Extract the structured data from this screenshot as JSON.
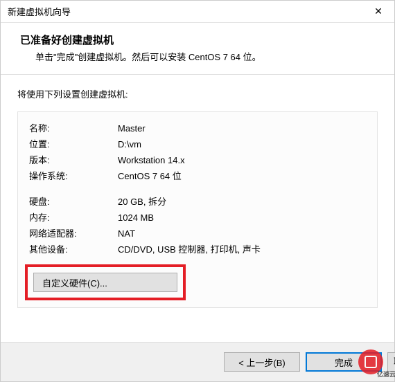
{
  "titlebar": {
    "title": "新建虚拟机向导",
    "close_label": "✕"
  },
  "header": {
    "title": "已准备好创建虚拟机",
    "desc": "单击\"完成\"创建虚拟机。然后可以安装 CentOS 7 64 位。"
  },
  "content": {
    "list_label": "将使用下列设置创建虚拟机:",
    "rows": [
      {
        "label": "名称:",
        "value": "Master"
      },
      {
        "label": "位置:",
        "value": "D:\\vm"
      },
      {
        "label": "版本:",
        "value": "Workstation 14.x"
      },
      {
        "label": "操作系统:",
        "value": "CentOS 7 64 位"
      }
    ],
    "rows2": [
      {
        "label": "硬盘:",
        "value": "20 GB, 拆分"
      },
      {
        "label": "内存:",
        "value": "1024 MB"
      },
      {
        "label": "网络适配器:",
        "value": "NAT"
      },
      {
        "label": "其他设备:",
        "value": "CD/DVD, USB 控制器, 打印机, 声卡"
      }
    ],
    "custom_hw_label": "自定义硬件(C)..."
  },
  "footer": {
    "back_label": "< 上一步(B)",
    "finish_label": "完成",
    "cancel_label": "取消"
  },
  "watermark": {
    "text": "亿速云"
  }
}
